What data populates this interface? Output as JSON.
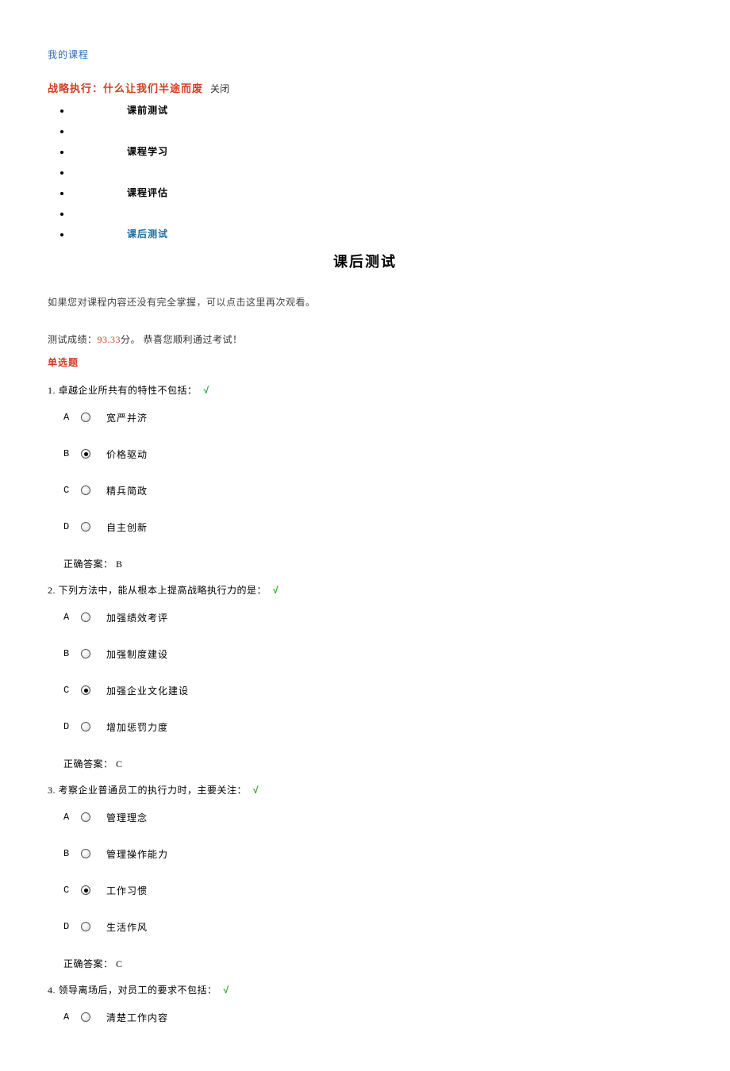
{
  "breadcrumb": "我的课程",
  "header": {
    "title": "战略执行：什么让我们半途而废",
    "close": "关闭"
  },
  "nav": [
    {
      "label": "课前测试",
      "bold": true,
      "active": false,
      "blank": false
    },
    {
      "label": "",
      "bold": false,
      "active": false,
      "blank": true
    },
    {
      "label": "课程学习",
      "bold": true,
      "active": false,
      "blank": false
    },
    {
      "label": "",
      "bold": false,
      "active": false,
      "blank": true
    },
    {
      "label": "课程评估",
      "bold": true,
      "active": false,
      "blank": false
    },
    {
      "label": "",
      "bold": false,
      "active": false,
      "blank": true
    },
    {
      "label": "课后测试",
      "bold": true,
      "active": true,
      "blank": false
    }
  ],
  "page_title": "课后测试",
  "hint": "如果您对课程内容还没有完全掌握，可以点击这里再次观看。",
  "score_line": {
    "prefix": "测试成绩：",
    "score": "93.33",
    "unit": "分。",
    "msg": " 恭喜您顺利通过考试！"
  },
  "section_label": "单选题",
  "ans_label": "正确答案：",
  "questions": [
    {
      "num": "1.",
      "text": "卓越企业所共有的特性不包括：",
      "correct_mark": "√",
      "options": [
        {
          "letter": "A",
          "text": "宽严并济",
          "selected": false
        },
        {
          "letter": "B",
          "text": "价格驱动",
          "selected": true
        },
        {
          "letter": "C",
          "text": "精兵简政",
          "selected": false
        },
        {
          "letter": "D",
          "text": "自主创新",
          "selected": false
        }
      ],
      "answer": "B"
    },
    {
      "num": "2.",
      "text": "下列方法中，能从根本上提高战略执行力的是：",
      "correct_mark": "√",
      "options": [
        {
          "letter": "A",
          "text": "加强绩效考评",
          "selected": false
        },
        {
          "letter": "B",
          "text": "加强制度建设",
          "selected": false
        },
        {
          "letter": "C",
          "text": "加强企业文化建设",
          "selected": true
        },
        {
          "letter": "D",
          "text": "增加惩罚力度",
          "selected": false
        }
      ],
      "answer": "C"
    },
    {
      "num": "3.",
      "text": "考察企业普通员工的执行力时，主要关注：",
      "correct_mark": "√",
      "options": [
        {
          "letter": "A",
          "text": "管理理念",
          "selected": false
        },
        {
          "letter": "B",
          "text": "管理操作能力",
          "selected": false
        },
        {
          "letter": "C",
          "text": "工作习惯",
          "selected": true
        },
        {
          "letter": "D",
          "text": "生活作风",
          "selected": false
        }
      ],
      "answer": "C"
    },
    {
      "num": "4.",
      "text": "领导离场后，对员工的要求不包括：",
      "correct_mark": "√",
      "options": [
        {
          "letter": "A",
          "text": "清楚工作内容",
          "selected": false
        }
      ],
      "answer": ""
    }
  ]
}
